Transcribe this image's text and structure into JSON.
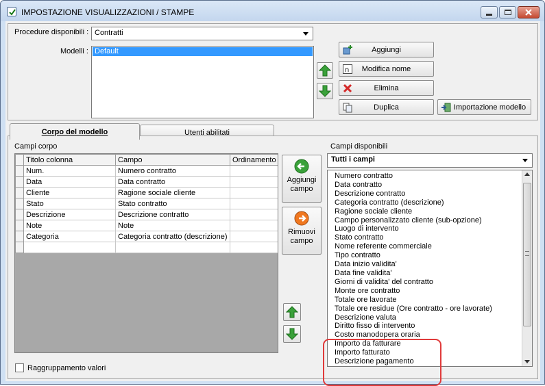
{
  "window": {
    "title": "IMPOSTAZIONE VISUALIZZAZIONI / STAMPE"
  },
  "procedure": {
    "label": "Procedure disponibili :",
    "selected": "Contratti"
  },
  "models": {
    "label": "Modelli :",
    "items": [
      "Default"
    ]
  },
  "buttons": {
    "add": "Aggiungi",
    "rename": "Modifica nome",
    "delete": "Elimina",
    "duplicate": "Duplica",
    "import": "Importazione modello",
    "add_field": "Aggiungi campo",
    "remove_field": "Rimuovi campo"
  },
  "tabs": [
    {
      "label": "Corpo del modello",
      "active": true
    },
    {
      "label": "Utenti abilitati",
      "active": false
    }
  ],
  "body_fields": {
    "label": "Campi corpo",
    "columns": [
      "Titolo colonna",
      "Campo",
      "Ordinamento"
    ],
    "rows": [
      {
        "title": "Num.",
        "field": "Numero contratto",
        "order": ""
      },
      {
        "title": "Data",
        "field": "Data contratto",
        "order": ""
      },
      {
        "title": "Cliente",
        "field": "Ragione sociale cliente",
        "order": ""
      },
      {
        "title": "Stato",
        "field": "Stato contratto",
        "order": ""
      },
      {
        "title": "Descrizione",
        "field": "Descrizione contratto",
        "order": ""
      },
      {
        "title": "Note",
        "field": "Note",
        "order": ""
      },
      {
        "title": "Categoria",
        "field": "Categoria contratto (descrizione)",
        "order": ""
      }
    ]
  },
  "available_fields": {
    "label": "Campi disponibili",
    "filter": "Tutti i campi",
    "items": [
      "Numero contratto",
      "Data contratto",
      "Descrizione contratto",
      "Categoria contratto (descrizione)",
      "Ragione sociale cliente",
      "Campo personalizzato cliente (sub-opzione)",
      "Luogo di intervento",
      "Stato contratto",
      "Nome referente commerciale",
      "Tipo contratto",
      "Data inizio validita'",
      "Data fine validita'",
      "Giorni di validita' del contratto",
      "Monte ore contratto",
      "Totale ore lavorate",
      "Totale ore residue (Ore contratto - ore lavorate)",
      "Descrizione valuta",
      "Diritto fisso di intervento",
      "Costo manodopera oraria",
      "Importo da fatturare",
      "Importo fatturato",
      "Descrizione pagamento"
    ]
  },
  "grouping": {
    "label": "Raggruppamento valori",
    "checked": false
  },
  "colors": {
    "highlight": "#e03a3a",
    "selection": "#3399ff",
    "arrow_green": "#3aa13a",
    "arrow_orange": "#f07820"
  }
}
